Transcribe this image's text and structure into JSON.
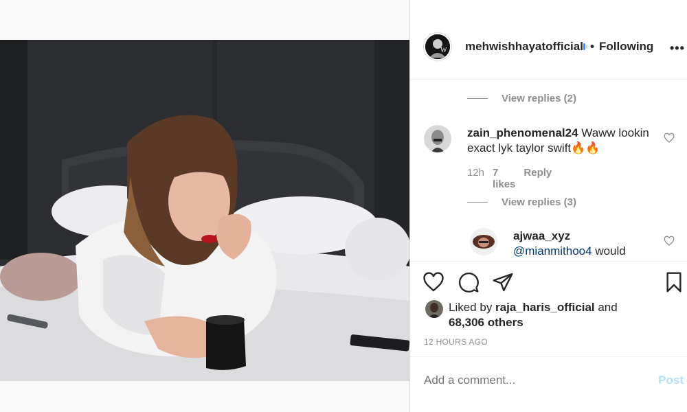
{
  "post": {
    "image_alt": "Woman lying on bed holding a black mug",
    "author": {
      "username": "mehwishhayatofficial",
      "follow_status": "Following",
      "separator": "•",
      "more_label": "•••"
    }
  },
  "comments": {
    "view_replies_1": "View replies (2)",
    "items": [
      {
        "username": "zain_phenomenal24",
        "text": " Waww lookin exact lyk taylor swift🔥🔥",
        "time": "12h",
        "likes": "7 likes",
        "reply": "Reply"
      },
      {
        "username": "ajwaa_xyz",
        "mention": "@mianmithoo4",
        "text": " would"
      }
    ],
    "view_replies_2": "View replies (3)"
  },
  "likes": {
    "prefix": "Liked by ",
    "liker": "raja_haris_official",
    "middle": " and",
    "others": "68,306 others"
  },
  "timestamp": "12 HOURS AGO",
  "add_comment": {
    "placeholder": "Add a comment...",
    "post_label": "Post"
  },
  "colors": {
    "post_button_disabled": "#b2dffc",
    "muted": "#8e8e8e",
    "border": "#dbdbdb"
  }
}
